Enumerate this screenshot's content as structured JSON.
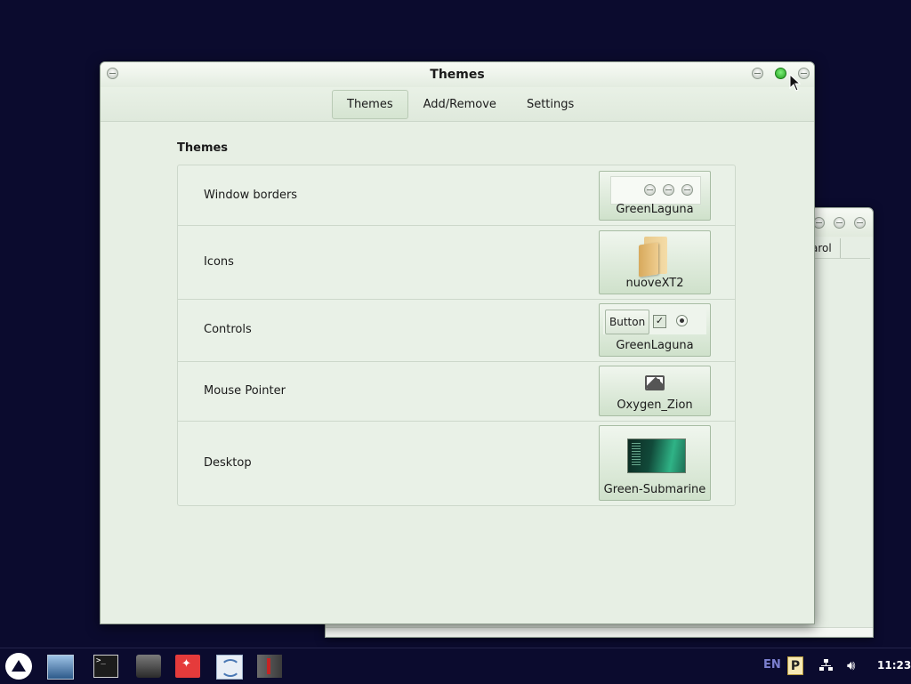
{
  "background_window": {
    "column_header": "arol"
  },
  "window": {
    "title": "Themes",
    "tabs": [
      {
        "label": "Themes",
        "active": true
      },
      {
        "label": "Add/Remove",
        "active": false
      },
      {
        "label": "Settings",
        "active": false
      }
    ],
    "section_title": "Themes",
    "rows": [
      {
        "label": "Window borders",
        "value": "GreenLaguna",
        "preview": "window-buttons"
      },
      {
        "label": "Icons",
        "value": "nuoveXT2",
        "preview": "folder-icon"
      },
      {
        "label": "Controls",
        "value": "GreenLaguna",
        "preview": "controls",
        "button_label": "Button"
      },
      {
        "label": "Mouse Pointer",
        "value": "Oxygen_Zion",
        "preview": "image-icon"
      },
      {
        "label": "Desktop",
        "value": "Green-Submarine",
        "preview": "desktop-thumbnail"
      }
    ]
  },
  "taskbar": {
    "apps": [
      "start-menu-icon",
      "file-manager-icon",
      "terminal-icon",
      "drive-icon",
      "red-app-icon",
      "map-icon",
      "suit-icon"
    ],
    "terminal_glyph": ">_",
    "keyboard_layout": "EN",
    "tray_p": "P",
    "clock": "11:23"
  },
  "colors": {
    "desktop_bg": "#0b0b2e",
    "window_bg": "#e7efe4",
    "maximize_button": "#2fbf2a",
    "keyboard_layout": "#7b7fcf"
  }
}
